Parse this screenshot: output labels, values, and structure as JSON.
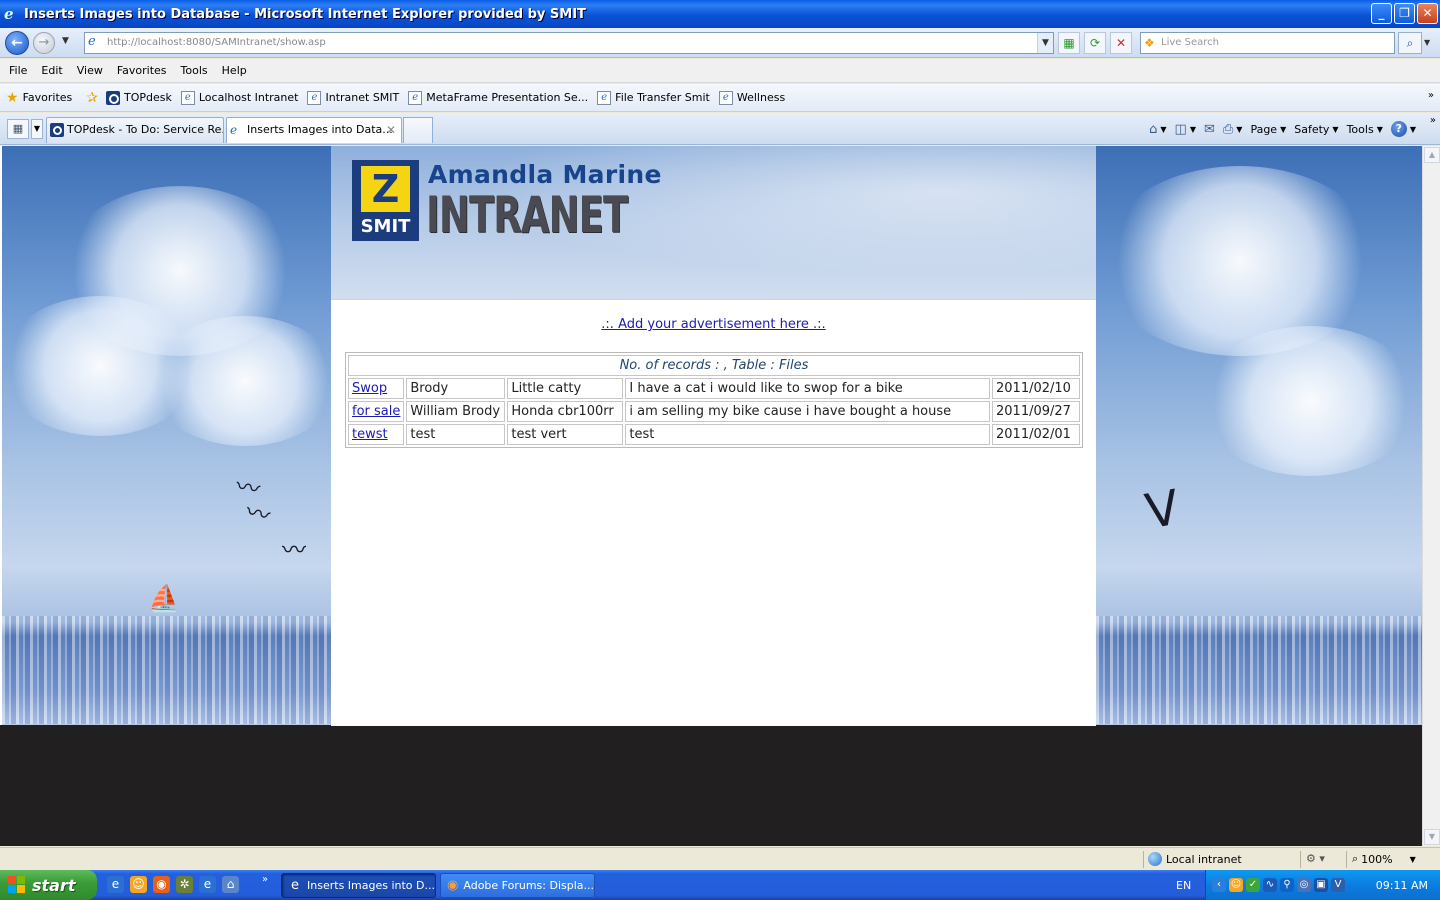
{
  "window": {
    "title": "Inserts Images into Database - Microsoft Internet Explorer provided by SMIT",
    "minimize": "_",
    "restore": "❐",
    "close": "✕"
  },
  "address_bar": {
    "url": "http://localhost:8080/SAMIntranet/show.asp",
    "search_placeholder": "Live Search"
  },
  "menu": [
    "File",
    "Edit",
    "View",
    "Favorites",
    "Tools",
    "Help"
  ],
  "favorites_bar": {
    "label": "Favorites",
    "links": [
      "TOPdesk",
      "Localhost Intranet",
      "Intranet SMIT",
      "MetaFrame Presentation Se...",
      "File Transfer Smit",
      "Wellness"
    ]
  },
  "tabs": [
    {
      "label": "TOPdesk - To Do: Service Re...",
      "active": false
    },
    {
      "label": "Inserts Images into Data...",
      "active": true
    }
  ],
  "command_bar": {
    "page": "Page",
    "safety": "Safety",
    "tools": "Tools"
  },
  "page": {
    "brand_line1": "Amandla Marine",
    "brand_line2": "INTRANET",
    "logo_text": "SMIT",
    "ad_link": ".:. Add your advertisement here .:.",
    "table_caption": "No. of records : , Table : Files",
    "rows": [
      {
        "link": "Swop",
        "name": "Brody",
        "title": "Little catty",
        "description": "I have a cat i would like to swop for a bike",
        "date": "2011/02/10"
      },
      {
        "link": "for sale",
        "name": "William Brody",
        "title": "Honda cbr100rr",
        "description": "i am selling my bike cause i have bought a house",
        "date": "2011/09/27"
      },
      {
        "link": "tewst",
        "name": "test",
        "title": "test vert",
        "description": "test",
        "date": "2011/02/01"
      }
    ]
  },
  "status_bar": {
    "zone": "Local intranet",
    "zoom": "100%"
  },
  "taskbar": {
    "start": "start",
    "tasks": [
      {
        "label": "Inserts Images into D...",
        "active": true
      },
      {
        "label": "Adobe Forums: Displa...",
        "active": false
      }
    ],
    "language": "EN",
    "clock": "09:11 AM"
  },
  "colors": {
    "title_bar": "#0a52d6",
    "link": "#1b1bb3",
    "logo_blue": "#1b3c7d",
    "logo_yellow": "#f5d414",
    "footer": "#211f20"
  }
}
